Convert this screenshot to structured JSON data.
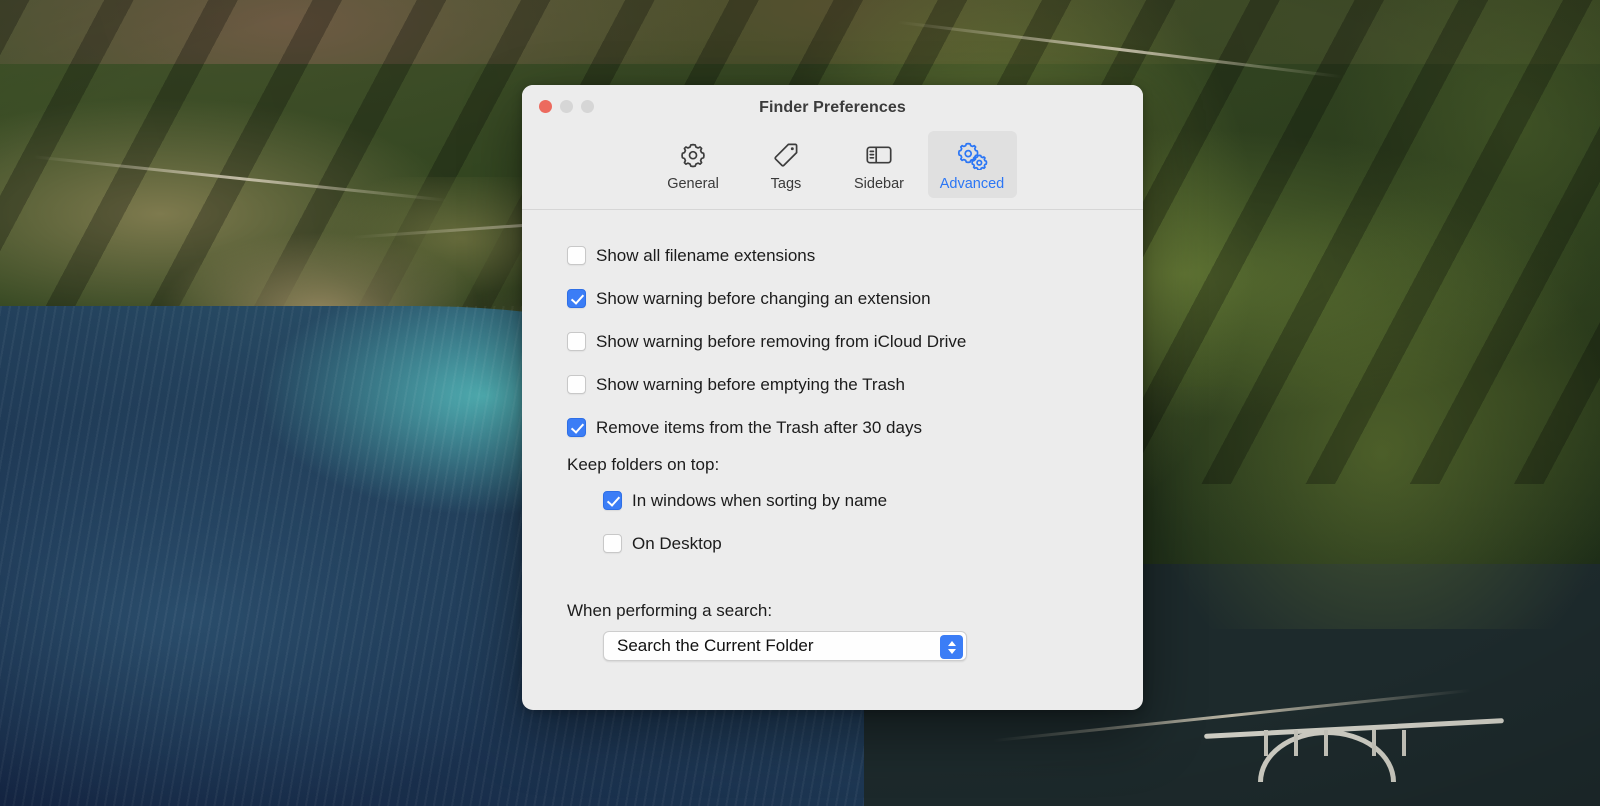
{
  "window": {
    "title": "Finder Preferences",
    "traffic_lights": [
      {
        "name": "close",
        "color": "#ec6a5e"
      },
      {
        "name": "minimize",
        "color": "#d6d6d6"
      },
      {
        "name": "zoom",
        "color": "#d6d6d6"
      }
    ]
  },
  "toolbar": {
    "items": [
      {
        "label": "General",
        "icon": "gear-icon",
        "selected": false
      },
      {
        "label": "Tags",
        "icon": "tag-icon",
        "selected": false
      },
      {
        "label": "Sidebar",
        "icon": "sidebar-icon",
        "selected": false
      },
      {
        "label": "Advanced",
        "icon": "double-gear-icon",
        "selected": true
      }
    ],
    "selected_color": "#2b76f5",
    "selected_background": "#e0e0e0"
  },
  "content": {
    "checkboxes": [
      {
        "label": "Show all filename extensions",
        "checked": false
      },
      {
        "label": "Show warning before changing an extension",
        "checked": true
      },
      {
        "label": "Show warning before removing from iCloud Drive",
        "checked": false
      },
      {
        "label": "Show warning before emptying the Trash",
        "checked": false
      },
      {
        "label": "Remove items from the Trash after 30 days",
        "checked": true
      }
    ],
    "keep_folders_group": {
      "label": "Keep folders on top:",
      "options": [
        {
          "label": "In windows when sorting by name",
          "checked": true
        },
        {
          "label": "On Desktop",
          "checked": false
        }
      ]
    },
    "search_group": {
      "label": "When performing a search:",
      "selected_option": "Search the Current Folder"
    }
  },
  "colors": {
    "accent_blue": "#3b7df6",
    "window_background": "#ececec",
    "text": "#1c1c1c"
  }
}
